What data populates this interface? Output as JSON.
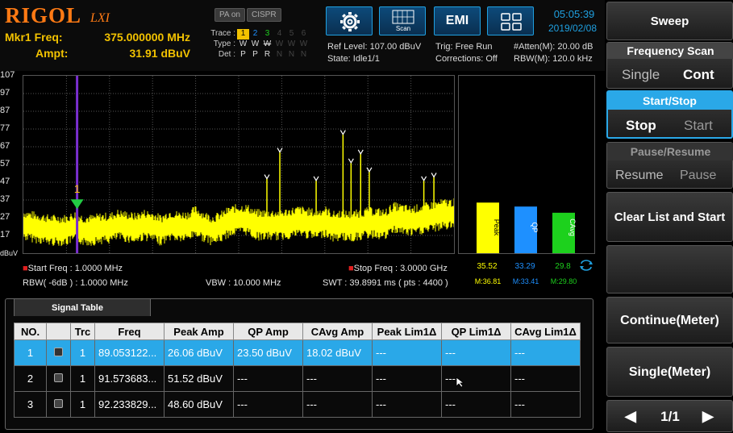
{
  "brand": {
    "logo": "RIGOL",
    "sub": "LXI"
  },
  "marker": {
    "freq_label": "Mkr1 Freq:",
    "freq_value": "375.000000 MHz",
    "ampt_label": "Ampt:",
    "ampt_value": "31.91 dBuV"
  },
  "pills": {
    "pa": "PA on",
    "cispr": "CISPR"
  },
  "trace": {
    "trace_label": "Trace :",
    "type_label": "Type :",
    "det_label": "Det :",
    "numbers": [
      "1",
      "2",
      "3",
      "4",
      "5",
      "6"
    ],
    "types": [
      "W",
      "W",
      "W",
      "W",
      "W",
      "W"
    ],
    "dets": [
      "P",
      "P",
      "R",
      "N",
      "N",
      "N"
    ]
  },
  "toolbar": {
    "scan_label": "Scan",
    "emi_label": "EMI"
  },
  "clock": {
    "time": "05:05:39",
    "date": "2019/02/08"
  },
  "status": {
    "ref_level": "Ref Level: 107.00 dBuV",
    "state": "State: Idle1/1",
    "trig": "Trig: Free Run",
    "corrections": "Corrections: Off",
    "atten": "#Atten(M): 20.00 dB",
    "rbw_m": "RBW(M): 120.0 kHz"
  },
  "chart_data": {
    "type": "line",
    "y_ticks": [
      "107",
      "97",
      "87",
      "77",
      "67",
      "57",
      "47",
      "37",
      "27",
      "17"
    ],
    "y_unit": "dBuV",
    "ylim": [
      7,
      107
    ],
    "xlim": [
      1,
      3000
    ],
    "x_unit": "MHz",
    "grid": true,
    "marker": {
      "label": "1",
      "x": 375,
      "y": 31.91
    },
    "spectrum_x": [
      1,
      60,
      120,
      180,
      240,
      300,
      360,
      420,
      480,
      540,
      600,
      660,
      720,
      780,
      840,
      900,
      960,
      1020,
      1080,
      1140,
      1200,
      1260,
      1320,
      1380,
      1440,
      1500,
      1560,
      1620,
      1680,
      1740,
      1800,
      1860,
      1920,
      1980,
      2040,
      2100,
      2160,
      2220,
      2280,
      2340,
      2400,
      2460,
      2520,
      2580,
      2640,
      2700,
      2760,
      2820,
      2880,
      2940,
      3000
    ],
    "spectrum_y": [
      27,
      26,
      25,
      24,
      24,
      24,
      26,
      24,
      24,
      25,
      25,
      27,
      26,
      25,
      27,
      26,
      24,
      27,
      26,
      26,
      29,
      26,
      24,
      26,
      29,
      30,
      30,
      27,
      27,
      27,
      27,
      28,
      29,
      28,
      27,
      29,
      26,
      27,
      26,
      27,
      28,
      28,
      27,
      31,
      30,
      29,
      30,
      31,
      32,
      33,
      33
    ],
    "peaks": [
      {
        "x": 1697,
        "y": 49
      },
      {
        "x": 1787,
        "y": 64
      },
      {
        "x": 2040,
        "y": 48
      },
      {
        "x": 2227,
        "y": 74
      },
      {
        "x": 2283,
        "y": 58
      },
      {
        "x": 2350,
        "y": 63
      },
      {
        "x": 2410,
        "y": 53
      },
      {
        "x": 2790,
        "y": 48
      },
      {
        "x": 2860,
        "y": 50
      }
    ],
    "bars": [
      {
        "name": "Peak",
        "value": 35.52,
        "max_label": "M:36.81",
        "color": "#ffff00"
      },
      {
        "name": "QP",
        "value": 33.29,
        "max_label": "M:33.41",
        "color": "#1e90ff"
      },
      {
        "name": "CAvg",
        "value": 29.8,
        "max_label": "M:29.80",
        "color": "#1dd11d"
      }
    ]
  },
  "foot": {
    "start_freq": "Start Freq : 1.0000 MHz",
    "stop_freq": "Stop Freq : 3.0000 GHz",
    "rbw": "RBW( -6dB ) : 1.0000 MHz",
    "vbw": "VBW : 10.000 MHz",
    "swt": "SWT : 39.8991 ms ( pts : 4400 )"
  },
  "signal_table": {
    "title": "Signal Table",
    "columns": [
      "NO.",
      "",
      "Trc",
      "Freq",
      "Peak Amp",
      "QP Amp",
      "CAvg Amp",
      "Peak Lim1Δ",
      "QP Lim1Δ",
      "CAvg Lim1Δ"
    ],
    "rows": [
      [
        "1",
        "",
        "1",
        "89.053122...",
        "26.06 dBuV",
        "23.50 dBuV",
        "18.02 dBuV",
        "---",
        "---",
        "---"
      ],
      [
        "2",
        "",
        "1",
        "91.573683...",
        "51.52 dBuV",
        "---",
        "---",
        "---",
        "---",
        "---"
      ],
      [
        "3",
        "",
        "1",
        "92.233829...",
        "48.60 dBuV",
        "---",
        "---",
        "---",
        "---",
        "---"
      ]
    ]
  },
  "right_panel": {
    "title": "Sweep",
    "freq_scan": {
      "head": "Frequency Scan",
      "a": "Single",
      "b": "Cont"
    },
    "start_stop": {
      "head": "Start/Stop",
      "a": "Stop",
      "b": "Start"
    },
    "pause_resume": {
      "head": "Pause/Resume",
      "a": "Resume",
      "b": "Pause"
    },
    "clear": "Clear List and Start",
    "cont_meter": "Continue(Meter)",
    "single_meter": "Single(Meter)",
    "page": "1/1"
  }
}
